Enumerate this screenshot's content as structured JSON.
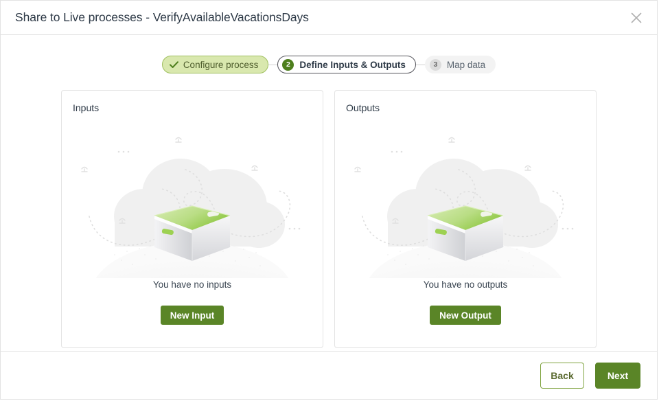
{
  "dialog": {
    "title": "Share to Live processes - VerifyAvailableVacationsDays",
    "close_icon": "close-icon"
  },
  "stepper": {
    "steps": [
      {
        "label": "Configure process",
        "state": "completed",
        "marker": "check"
      },
      {
        "label": "Define Inputs & Outputs",
        "state": "current",
        "marker": "2"
      },
      {
        "label": "Map data",
        "state": "upcoming",
        "marker": "3"
      }
    ]
  },
  "panels": [
    {
      "title": "Inputs",
      "empty_text": "You have no inputs",
      "action_label": "New Input",
      "illustration": "empty-box-illustration"
    },
    {
      "title": "Outputs",
      "empty_text": "You have no outputs",
      "action_label": "New Output",
      "illustration": "empty-box-illustration"
    }
  ],
  "footer": {
    "back_label": "Back",
    "next_label": "Next"
  },
  "colors": {
    "accent_green": "#5a8527",
    "badge_green": "#4e7f1d",
    "step_done_bg": "#d9e8ae",
    "step_done_border": "#9fbf5f",
    "box_green_light": "#c9e59c",
    "box_green_dark": "#8cc63f",
    "border_gray": "#e3e3e3",
    "text_dark": "#2e3a47"
  }
}
